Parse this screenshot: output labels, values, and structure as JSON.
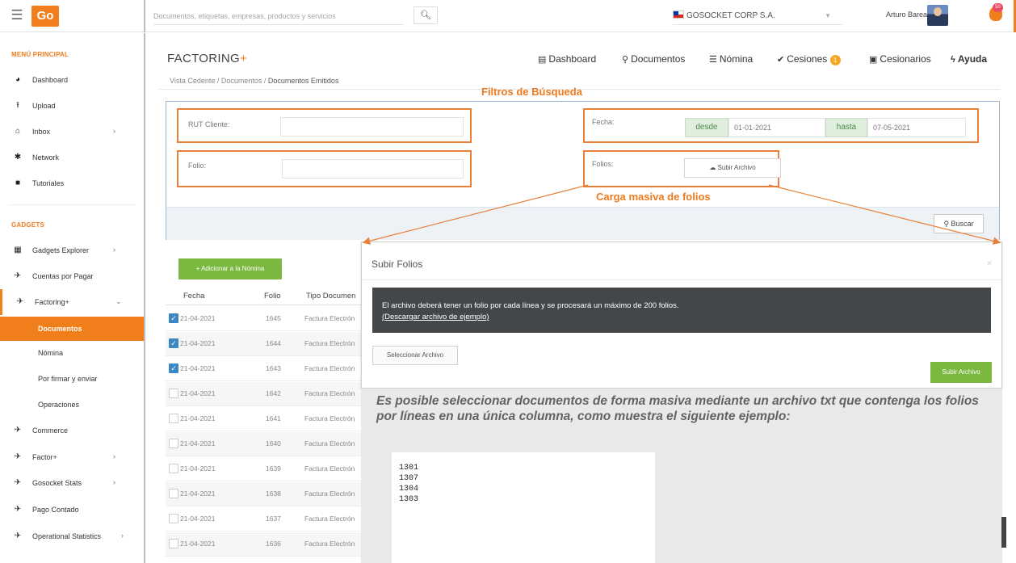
{
  "header": {
    "logo_text": "Go",
    "search_placeholder": "Documentos, etiquetas, empresas, productos y servicios",
    "company": "GOSOCKET CORP S.A.",
    "user_name": "Arturo Barea",
    "notifications": "50"
  },
  "sidebar": {
    "main_heading": "MENÚ PRINCIPAL",
    "main_items": [
      {
        "label": "Dashboard",
        "icon": "dashboard-icon"
      },
      {
        "label": "Upload",
        "icon": "upload-icon"
      },
      {
        "label": "Inbox",
        "icon": "inbox-icon"
      },
      {
        "label": "Network",
        "icon": "network-icon"
      },
      {
        "label": "Tutoriales",
        "icon": "video-icon"
      }
    ],
    "gadgets_heading": "GADGETS",
    "gadget_items": [
      {
        "label": "Gadgets Explorer"
      },
      {
        "label": "Cuentas por Pagar"
      },
      {
        "label": "Factoring+"
      }
    ],
    "factoring_sub": [
      {
        "label": "Documentos"
      },
      {
        "label": "Nómina"
      },
      {
        "label": "Por firmar y enviar"
      },
      {
        "label": "Operaciones"
      }
    ],
    "more_items": [
      {
        "label": "Commerce"
      },
      {
        "label": "Factor+"
      },
      {
        "label": "Gosocket Stats"
      },
      {
        "label": "Pago Contado"
      },
      {
        "label": "Operational Statistics"
      }
    ]
  },
  "main": {
    "title": "FACTORING",
    "title_plus": "+",
    "nav": {
      "dashboard": "Dashboard",
      "documentos": "Documentos",
      "nomina": "Nómina",
      "cesiones": "Cesiones",
      "cesiones_badge": "1",
      "cesionarios": "Cesionarios",
      "ayuda": "Ayuda"
    },
    "breadcrumb_prefix": "Vista Cedente / Documentos / ",
    "breadcrumb_current": "Documentos Emitidos"
  },
  "annotations": {
    "filters_title": "Filtros de Búsqueda",
    "bulk_title": "Carga masiva de folios"
  },
  "filters": {
    "rut_label": "RUT Cliente:",
    "folio_label": "Folio:",
    "fecha_label": "Fecha:",
    "desde_label": "desde",
    "desde_value": "01-01-2021",
    "hasta_label": "hasta",
    "hasta_value": "07-05-2021",
    "folios_label": "Folios:",
    "subir_archivo": "Subir Archivo",
    "buscar": "Buscar"
  },
  "table": {
    "add_button": "+ Adicionar a la Nómina",
    "headers": {
      "fecha": "Fecha",
      "folio": "Folio",
      "tipo": "Tipo Documen"
    },
    "rows": [
      {
        "checked": true,
        "fecha": "21-04-2021",
        "folio": "1645",
        "tipo": "Factura Electrón"
      },
      {
        "checked": true,
        "fecha": "21-04-2021",
        "folio": "1644",
        "tipo": "Factura Electrón"
      },
      {
        "checked": true,
        "fecha": "21-04-2021",
        "folio": "1643",
        "tipo": "Factura Electrón"
      },
      {
        "checked": false,
        "fecha": "21-04-2021",
        "folio": "1642",
        "tipo": "Factura Electrón"
      },
      {
        "checked": false,
        "fecha": "21-04-2021",
        "folio": "1641",
        "tipo": "Factura Electrón"
      },
      {
        "checked": false,
        "fecha": "21-04-2021",
        "folio": "1640",
        "tipo": "Factura Electrón"
      },
      {
        "checked": false,
        "fecha": "21-04-2021",
        "folio": "1639",
        "tipo": "Factura Electrón"
      },
      {
        "checked": false,
        "fecha": "21-04-2021",
        "folio": "1638",
        "tipo": "Factura Electrón"
      },
      {
        "checked": false,
        "fecha": "21-04-2021",
        "folio": "1637",
        "tipo": "Factura Electrón"
      },
      {
        "checked": false,
        "fecha": "21-04-2021",
        "folio": "1636",
        "tipo": "Factura Electrón"
      }
    ]
  },
  "modal": {
    "title": "Subir Folios",
    "close": "×",
    "info": "El archivo deberá tener un folio por cada línea y se procesará un máximo de 200 folios.",
    "sample_link": "(Descargar archivo de ejemplo)",
    "select_button": "Seleccionar Archivo",
    "upload_button": "Subir Archivo"
  },
  "note": {
    "text": "Es posible seleccionar documentos de forma masiva mediante un archivo txt que contenga los folios por líneas en una única columna, como muestra el siguiente ejemplo:",
    "sample_lines": [
      "1301",
      "1307",
      "1304",
      "1303"
    ]
  },
  "colors": {
    "accent": "#f07e1a",
    "green": "#7ab83f",
    "annotation": "#e8803a"
  }
}
